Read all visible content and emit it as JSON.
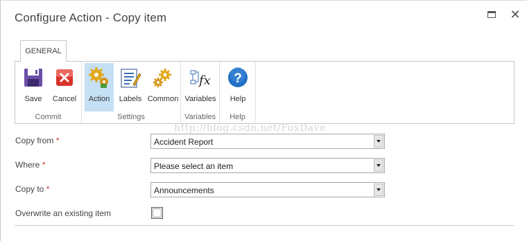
{
  "window": {
    "title": "Configure Action - Copy item",
    "maximize_icon": "maximize-icon",
    "close_icon": "close-icon",
    "close_glyph": "✕"
  },
  "ribbon": {
    "active_tab": "GENERAL",
    "groups": [
      {
        "label": "Commit",
        "buttons": [
          {
            "label": "Save",
            "icon": "save-icon"
          },
          {
            "label": "Cancel",
            "icon": "cancel-icon"
          }
        ]
      },
      {
        "label": "Settings",
        "buttons": [
          {
            "label": "Action",
            "icon": "gears-icon",
            "selected": true
          },
          {
            "label": "Labels",
            "icon": "labels-icon"
          },
          {
            "label": "Common",
            "icon": "gears-icon"
          }
        ]
      },
      {
        "label": "Variables",
        "buttons": [
          {
            "label": "Variables",
            "icon": "variables-fx-icon"
          }
        ]
      },
      {
        "label": "Help",
        "buttons": [
          {
            "label": "Help",
            "icon": "help-icon"
          }
        ]
      }
    ]
  },
  "watermark": "http://blog.csdn.net/FoxDave",
  "form": {
    "required_marker": "*",
    "copy_from": {
      "label": "Copy from",
      "value": "Accident Report"
    },
    "where": {
      "label": "Where",
      "value": "Please select an item"
    },
    "copy_to": {
      "label": "Copy to",
      "value": "Announcements"
    },
    "overwrite": {
      "label": "Overwrite an existing item",
      "checked": false
    }
  },
  "colors": {
    "selected_button_bg": "#c5e0f5",
    "required": "#c0392b",
    "help_blue": "#1f6fc5",
    "cancel_red": "#d9342b"
  }
}
